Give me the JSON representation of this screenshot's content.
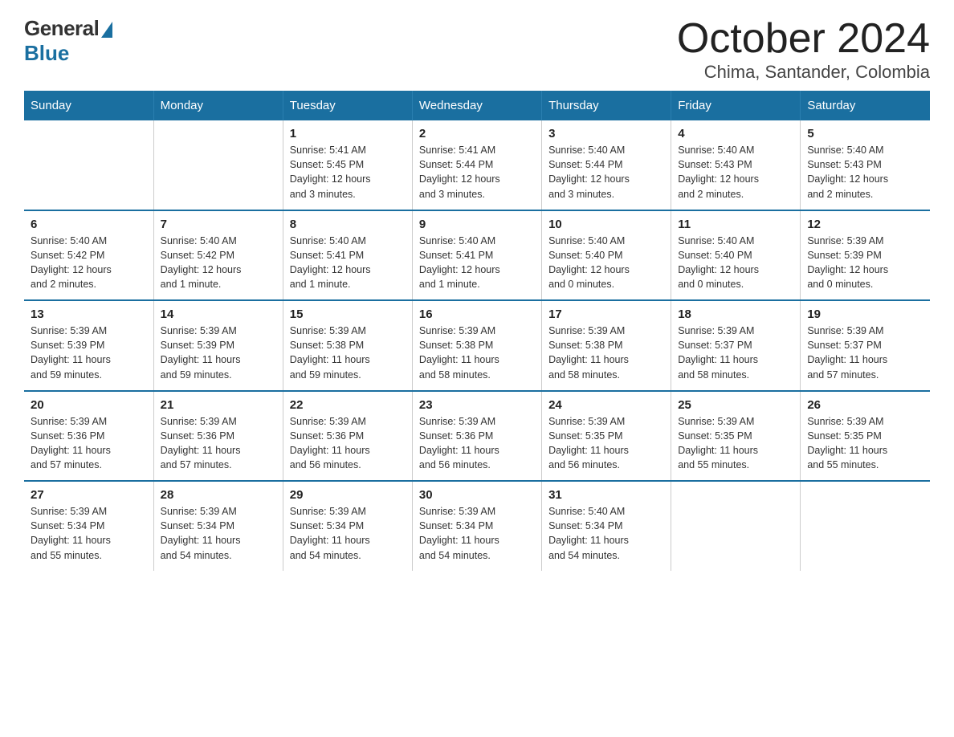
{
  "header": {
    "logo": {
      "general": "General",
      "blue": "Blue"
    },
    "title": "October 2024",
    "location": "Chima, Santander, Colombia"
  },
  "days_header": [
    "Sunday",
    "Monday",
    "Tuesday",
    "Wednesday",
    "Thursday",
    "Friday",
    "Saturday"
  ],
  "weeks": [
    [
      {
        "day": "",
        "info": ""
      },
      {
        "day": "",
        "info": ""
      },
      {
        "day": "1",
        "info": "Sunrise: 5:41 AM\nSunset: 5:45 PM\nDaylight: 12 hours\nand 3 minutes."
      },
      {
        "day": "2",
        "info": "Sunrise: 5:41 AM\nSunset: 5:44 PM\nDaylight: 12 hours\nand 3 minutes."
      },
      {
        "day": "3",
        "info": "Sunrise: 5:40 AM\nSunset: 5:44 PM\nDaylight: 12 hours\nand 3 minutes."
      },
      {
        "day": "4",
        "info": "Sunrise: 5:40 AM\nSunset: 5:43 PM\nDaylight: 12 hours\nand 2 minutes."
      },
      {
        "day": "5",
        "info": "Sunrise: 5:40 AM\nSunset: 5:43 PM\nDaylight: 12 hours\nand 2 minutes."
      }
    ],
    [
      {
        "day": "6",
        "info": "Sunrise: 5:40 AM\nSunset: 5:42 PM\nDaylight: 12 hours\nand 2 minutes."
      },
      {
        "day": "7",
        "info": "Sunrise: 5:40 AM\nSunset: 5:42 PM\nDaylight: 12 hours\nand 1 minute."
      },
      {
        "day": "8",
        "info": "Sunrise: 5:40 AM\nSunset: 5:41 PM\nDaylight: 12 hours\nand 1 minute."
      },
      {
        "day": "9",
        "info": "Sunrise: 5:40 AM\nSunset: 5:41 PM\nDaylight: 12 hours\nand 1 minute."
      },
      {
        "day": "10",
        "info": "Sunrise: 5:40 AM\nSunset: 5:40 PM\nDaylight: 12 hours\nand 0 minutes."
      },
      {
        "day": "11",
        "info": "Sunrise: 5:40 AM\nSunset: 5:40 PM\nDaylight: 12 hours\nand 0 minutes."
      },
      {
        "day": "12",
        "info": "Sunrise: 5:39 AM\nSunset: 5:39 PM\nDaylight: 12 hours\nand 0 minutes."
      }
    ],
    [
      {
        "day": "13",
        "info": "Sunrise: 5:39 AM\nSunset: 5:39 PM\nDaylight: 11 hours\nand 59 minutes."
      },
      {
        "day": "14",
        "info": "Sunrise: 5:39 AM\nSunset: 5:39 PM\nDaylight: 11 hours\nand 59 minutes."
      },
      {
        "day": "15",
        "info": "Sunrise: 5:39 AM\nSunset: 5:38 PM\nDaylight: 11 hours\nand 59 minutes."
      },
      {
        "day": "16",
        "info": "Sunrise: 5:39 AM\nSunset: 5:38 PM\nDaylight: 11 hours\nand 58 minutes."
      },
      {
        "day": "17",
        "info": "Sunrise: 5:39 AM\nSunset: 5:38 PM\nDaylight: 11 hours\nand 58 minutes."
      },
      {
        "day": "18",
        "info": "Sunrise: 5:39 AM\nSunset: 5:37 PM\nDaylight: 11 hours\nand 58 minutes."
      },
      {
        "day": "19",
        "info": "Sunrise: 5:39 AM\nSunset: 5:37 PM\nDaylight: 11 hours\nand 57 minutes."
      }
    ],
    [
      {
        "day": "20",
        "info": "Sunrise: 5:39 AM\nSunset: 5:36 PM\nDaylight: 11 hours\nand 57 minutes."
      },
      {
        "day": "21",
        "info": "Sunrise: 5:39 AM\nSunset: 5:36 PM\nDaylight: 11 hours\nand 57 minutes."
      },
      {
        "day": "22",
        "info": "Sunrise: 5:39 AM\nSunset: 5:36 PM\nDaylight: 11 hours\nand 56 minutes."
      },
      {
        "day": "23",
        "info": "Sunrise: 5:39 AM\nSunset: 5:36 PM\nDaylight: 11 hours\nand 56 minutes."
      },
      {
        "day": "24",
        "info": "Sunrise: 5:39 AM\nSunset: 5:35 PM\nDaylight: 11 hours\nand 56 minutes."
      },
      {
        "day": "25",
        "info": "Sunrise: 5:39 AM\nSunset: 5:35 PM\nDaylight: 11 hours\nand 55 minutes."
      },
      {
        "day": "26",
        "info": "Sunrise: 5:39 AM\nSunset: 5:35 PM\nDaylight: 11 hours\nand 55 minutes."
      }
    ],
    [
      {
        "day": "27",
        "info": "Sunrise: 5:39 AM\nSunset: 5:34 PM\nDaylight: 11 hours\nand 55 minutes."
      },
      {
        "day": "28",
        "info": "Sunrise: 5:39 AM\nSunset: 5:34 PM\nDaylight: 11 hours\nand 54 minutes."
      },
      {
        "day": "29",
        "info": "Sunrise: 5:39 AM\nSunset: 5:34 PM\nDaylight: 11 hours\nand 54 minutes."
      },
      {
        "day": "30",
        "info": "Sunrise: 5:39 AM\nSunset: 5:34 PM\nDaylight: 11 hours\nand 54 minutes."
      },
      {
        "day": "31",
        "info": "Sunrise: 5:40 AM\nSunset: 5:34 PM\nDaylight: 11 hours\nand 54 minutes."
      },
      {
        "day": "",
        "info": ""
      },
      {
        "day": "",
        "info": ""
      }
    ]
  ]
}
